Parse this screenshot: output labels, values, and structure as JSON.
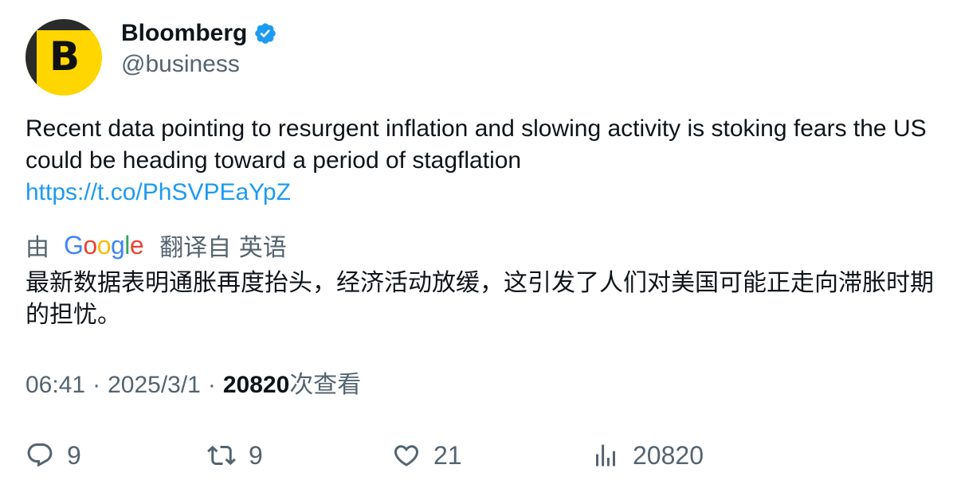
{
  "author": {
    "display_name": "Bloomberg",
    "handle": "@business",
    "avatar_letter": "B",
    "verified": true,
    "avatar_color": "#ffd600"
  },
  "tweet": {
    "text": "Recent data pointing to resurgent inflation and slowing activity is stoking fears the US could be heading toward a period of stagflation",
    "link": "https://t.co/PhSVPEaYpZ"
  },
  "translation": {
    "prefix": "由",
    "provider": "Google",
    "suffix": "翻译自 英语",
    "text": "最新数据表明通胀再度抬头，经济活动放缓，这引发了人们对美国可能正走向滞胀时期的担忧。"
  },
  "meta": {
    "time": "06:41",
    "date": "2025/3/1",
    "separator": "·",
    "views_count": "20820",
    "views_label": "次查看"
  },
  "actions": {
    "reply_count": "9",
    "retweet_count": "9",
    "like_count": "21",
    "views_count": "20820"
  },
  "colors": {
    "link": "#1d9bf0",
    "secondary_text": "#536471",
    "primary_text": "#0f1419",
    "verified_badge": "#1d9bf0"
  }
}
